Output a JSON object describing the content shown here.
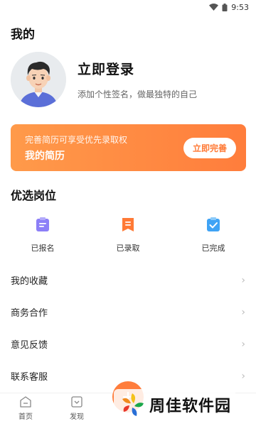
{
  "status_bar": {
    "time": "9:53"
  },
  "header": {
    "title": "我的"
  },
  "profile": {
    "login_label": "立即登录",
    "signature": "添加个性签名，做最独特的自己"
  },
  "resume_banner": {
    "subtitle": "完善简历可享受优先录取权",
    "title": "我的简历",
    "button": "立即完善"
  },
  "jobs_section": {
    "title": "优选岗位",
    "items": [
      {
        "label": "已报名",
        "icon": "applied-icon",
        "color": "#7b6cf6"
      },
      {
        "label": "已录取",
        "icon": "hired-icon",
        "color": "#ff7a36"
      },
      {
        "label": "已完成",
        "icon": "completed-icon",
        "color": "#3fa3f5"
      }
    ]
  },
  "menu": [
    {
      "label": "我的收藏"
    },
    {
      "label": "商务合作"
    },
    {
      "label": "意见反馈"
    },
    {
      "label": "联系客服"
    }
  ],
  "tabbar": [
    {
      "label": "首页",
      "icon": "home-icon"
    },
    {
      "label": "发现",
      "icon": "discover-icon"
    }
  ],
  "watermark": {
    "text": "周佳软件园"
  },
  "colors": {
    "accent": "#ff7d3c",
    "accent_light": "#ff9a4a"
  }
}
